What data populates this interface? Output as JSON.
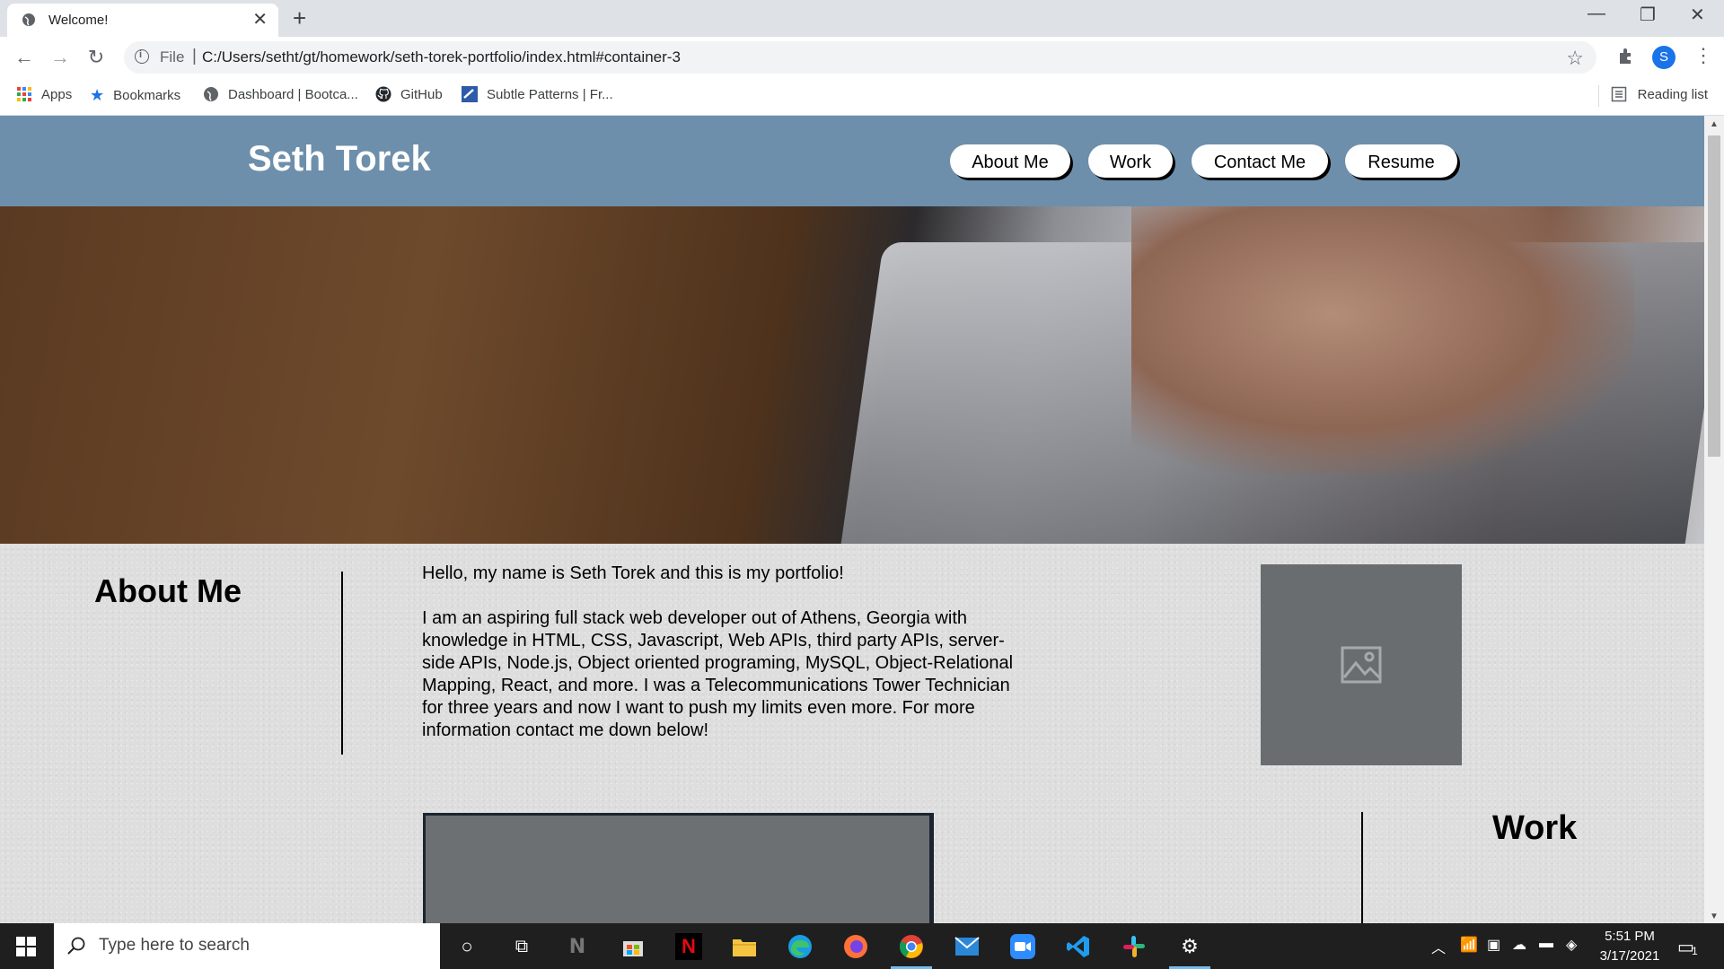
{
  "browser": {
    "tab_title": "Welcome!",
    "tab_close": "✕",
    "new_tab": "+",
    "url_scheme": "File",
    "url_separator": "|",
    "url": "C:/Users/setht/gt/homework/seth-torek-portfolio/index.html#container-3",
    "profile_initial": "S",
    "bookmarks": [
      {
        "label": "Apps",
        "icon": "apps-grid-icon"
      },
      {
        "label": "Bookmarks",
        "icon": "star-icon"
      },
      {
        "label": "Dashboard | Bootca...",
        "icon": "globe-icon"
      },
      {
        "label": "GitHub",
        "icon": "github-icon"
      },
      {
        "label": "Subtle Patterns | Fr...",
        "icon": "subtle-patterns-icon"
      }
    ],
    "reading_list": "Reading list"
  },
  "site": {
    "title": "Seth Torek",
    "nav": [
      "About Me",
      "Work",
      "Contact Me",
      "Resume"
    ],
    "about": {
      "heading": "About Me",
      "paragraph1": "Hello, my name is Seth Torek and this is my portfolio!",
      "paragraph2": "I am an aspiring full stack web developer out of Athens, Georgia with knowledge in HTML, CSS, Javascript, Web APIs, third party APIs, server-side APIs, Node.js, Object oriented programing, MySQL, Object-Relational Mapping, React, and more. I was a Telecommunications Tower Technician for three years and now I want to push my limits even more. For more information contact me down below!"
    },
    "work": {
      "heading": "Work"
    },
    "colors": {
      "header": "#6d8fab",
      "placeholder": "#696d70"
    }
  },
  "taskbar": {
    "search_placeholder": "Type here to search",
    "time": "5:51 PM",
    "date": "3/17/2021",
    "notification_count": "1"
  }
}
